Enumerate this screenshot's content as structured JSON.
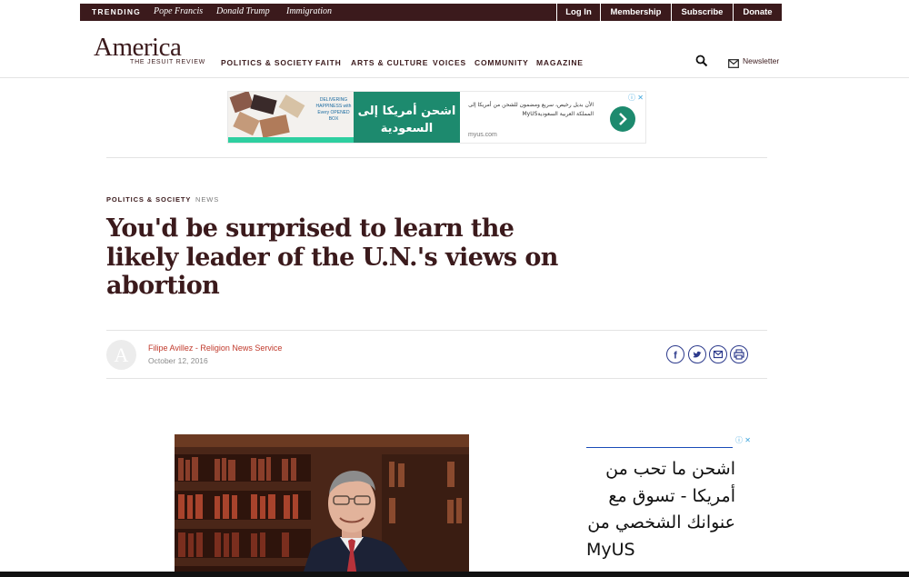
{
  "topbar": {
    "trending_label": "TRENDING",
    "trending_links": [
      "Pope Francis",
      "Donald Trump",
      "Immigration"
    ],
    "buttons": [
      "Log In",
      "Membership",
      "Subscribe",
      "Donate"
    ]
  },
  "header": {
    "logo": "America",
    "logo_sub": "THE JESUIT REVIEW",
    "nav": [
      "POLITICS & SOCIETY",
      "FAITH",
      "ARTS & CULTURE",
      "VOICES",
      "COMMUNITY",
      "MAGAZINE"
    ],
    "newsletter_label": "Newsletter",
    "search_icon": "search-icon",
    "mail_icon": "mail-icon"
  },
  "ad_top": {
    "headline": "اشحن أمريكا إلى السعودية",
    "body": "الأن بديل رخيص، سريع ومضمون للشحن من أمريكا إلى المملكة العربية السعوديةMyUS",
    "domain": "myus.com",
    "box_text": "DELIVERING HAPPINESS with Every OPENED BOX",
    "adchoices": "ⓘ ✕"
  },
  "article": {
    "section": "POLITICS & SOCIETY",
    "type": "NEWS",
    "headline": "You'd be surprised to learn the likely leader of the U.N.'s views on abortion",
    "author": "Filipe Avillez - Religion News Service",
    "date": "October 12, 2016",
    "share_icons": [
      "facebook-icon",
      "twitter-icon",
      "email-icon",
      "print-icon"
    ]
  },
  "ad_side": {
    "lines": [
      "اشحن ما تحب من",
      "أمريكا - تسوق مع",
      "عنوانك الشخصي من",
      "MyUS"
    ],
    "adchoices": "ⓘ ✕"
  },
  "colors": {
    "brand": "#3b1a1c",
    "accent_red": "#c0392b",
    "share_blue": "#2c3a8c",
    "ad_green": "#1d8a6e"
  }
}
